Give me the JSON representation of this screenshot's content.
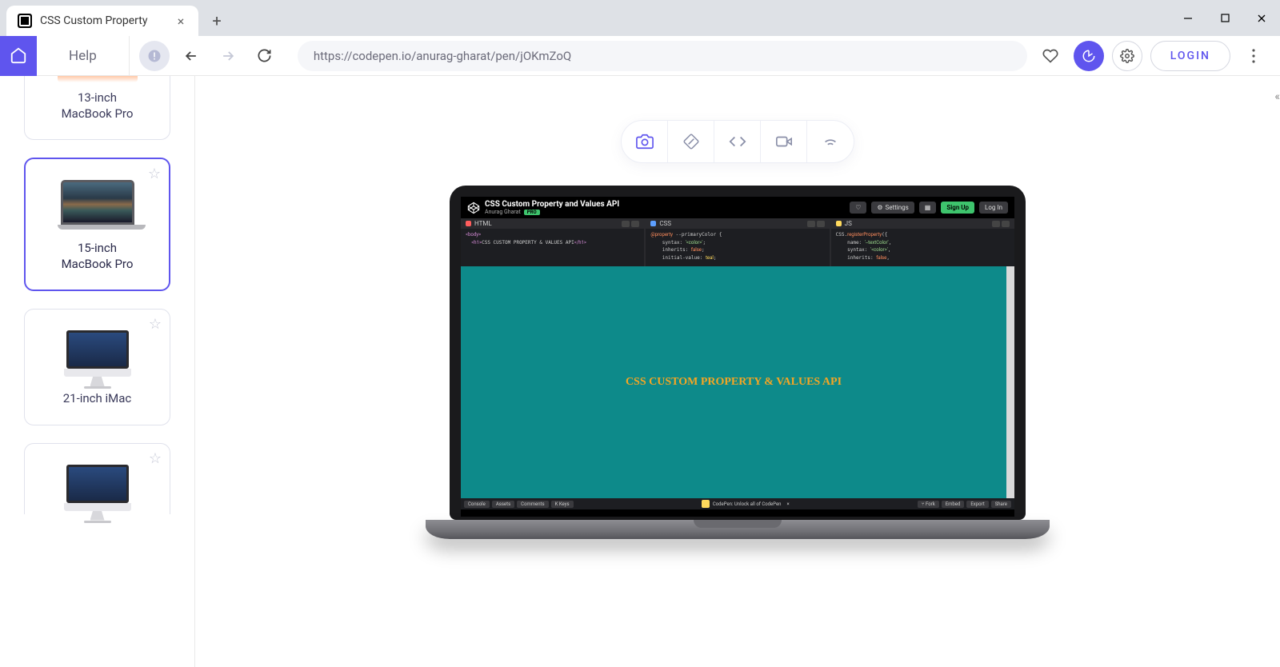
{
  "titlebar": {
    "tab_title": "CSS Custom Property",
    "new_tab": "+",
    "minimize": "—",
    "maximize": "☐",
    "close": "✕"
  },
  "toolbar": {
    "help_label": "Help",
    "url": "https://codepen.io/anurag-gharat/pen/jOKmZoQ",
    "login_label": "LOGIN"
  },
  "sidebar": {
    "devices": [
      {
        "label_line1": "13-inch",
        "label_line2": "MacBook Pro"
      },
      {
        "label_line1": "15-inch",
        "label_line2": "MacBook Pro"
      },
      {
        "label_line1": "21-inch iMac",
        "label_line2": ""
      },
      {
        "label_line1": "",
        "label_line2": ""
      }
    ]
  },
  "codepen": {
    "title": "CSS Custom Property and Values API",
    "author": "Anurag Gharat",
    "pro": "PRO",
    "settings": "Settings",
    "signup": "Sign Up",
    "login": "Log In",
    "panels": {
      "html": {
        "label": "HTML",
        "code": "<body>\n  <h1>CSS CUSTOM PROPERTY & VALUES API</h1>"
      },
      "css": {
        "label": "CSS",
        "code": "@property --primaryColor {\n    syntax: '<color>';\n    inherits: false;\n    initial-value: teal;"
      },
      "js": {
        "label": "JS",
        "code": "CSS.registerProperty({\n    name: '--textColor',\n    syntax: '<color>',\n    inherits: false,"
      }
    },
    "output_text": "CSS CUSTOM PROPERTY & VALUES API",
    "footer": {
      "console": "Console",
      "assets": "Assets",
      "comments": "Comments",
      "keys": "K Keys",
      "banner": "CodePen: Unlock all of CodePen",
      "fork": "⑂ Fork",
      "embed": "Embed",
      "export": "Export",
      "share": "Share"
    }
  }
}
